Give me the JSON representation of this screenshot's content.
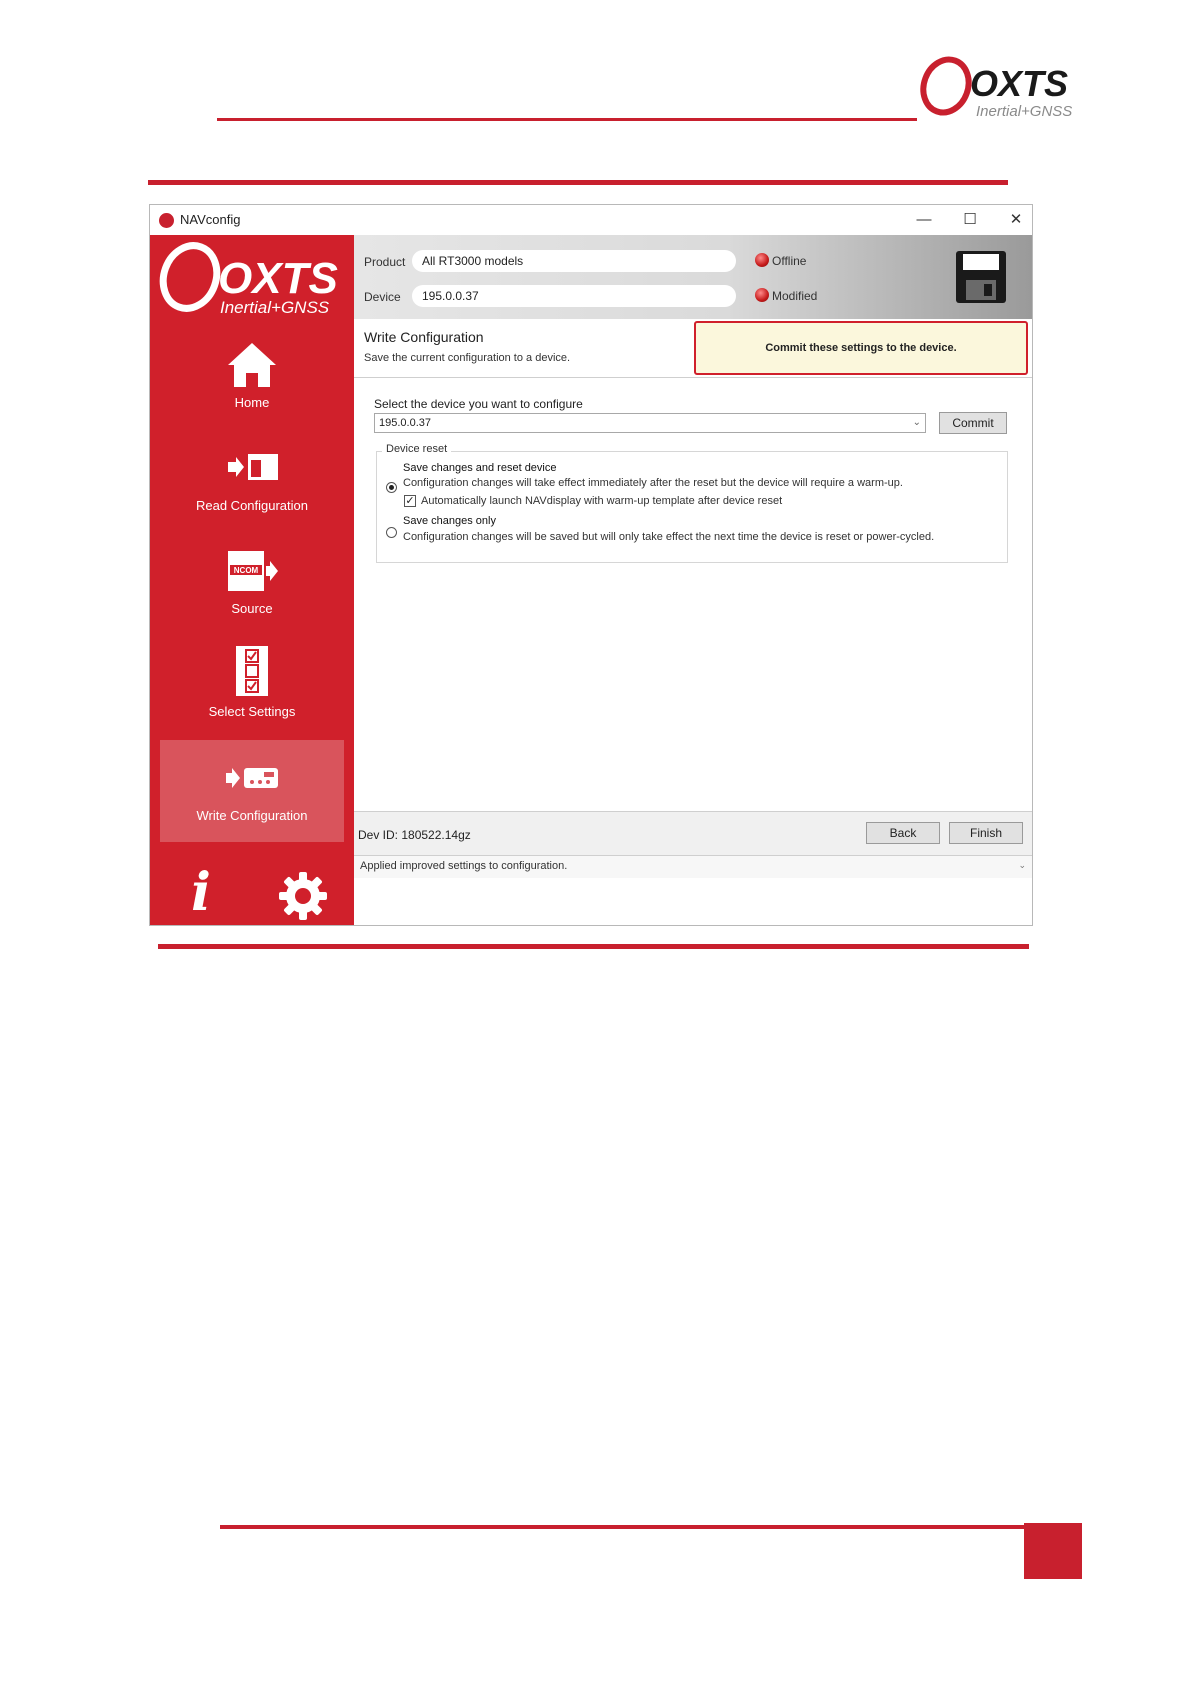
{
  "page": {
    "logo_main": "OXTS",
    "logo_sub": "Inertial+GNSS"
  },
  "window": {
    "title": "NAVconfig",
    "controls": {
      "minimize": "—",
      "maximize": "☐",
      "close": "✕"
    }
  },
  "sidebar": {
    "logo_main": "OXTS",
    "logo_sub": "Inertial+GNSS",
    "items": [
      {
        "label": "Home",
        "icon": "home-icon"
      },
      {
        "label": "Read Configuration",
        "icon": "read-configuration-icon"
      },
      {
        "label": "Source",
        "icon": "ncom-source-icon",
        "badge": "NCOM"
      },
      {
        "label": "Select Settings",
        "icon": "select-settings-icon"
      },
      {
        "label": "Write Configuration",
        "icon": "write-configuration-icon",
        "active": true
      }
    ],
    "info_glyph": "i"
  },
  "topstrip": {
    "product_label": "Product",
    "product_value": "All RT3000 models",
    "device_label": "Device",
    "device_value": "195.0.0.37",
    "status_offline": "Offline",
    "status_modified": "Modified"
  },
  "main": {
    "title": "Write Configuration",
    "subtitle": "Save the current configuration to a device.",
    "tip": "Commit these settings to the device.",
    "select_label": "Select the device you want to configure",
    "select_value": "195.0.0.37",
    "commit_label": "Commit",
    "group_label": "Device reset",
    "option1_title": "Save changes and reset device",
    "option1_desc": "Configuration changes will take effect immediately after the reset but the device will require a warm-up.",
    "option1_checkbox": "Automatically launch NAVdisplay with warm-up template after device reset",
    "option2_title": "Save changes only",
    "option2_desc": "Configuration changes will be saved but will only take effect the next time the device is reset or power-cycled.",
    "dev_id": "Dev ID: 180522.14gz",
    "back_label": "Back",
    "finish_label": "Finish",
    "status": "Applied improved settings to configuration."
  },
  "colors": {
    "brand_red": "#c8202e",
    "sidebar_red": "#d0202b",
    "tip_bg": "#fbf7dc"
  }
}
